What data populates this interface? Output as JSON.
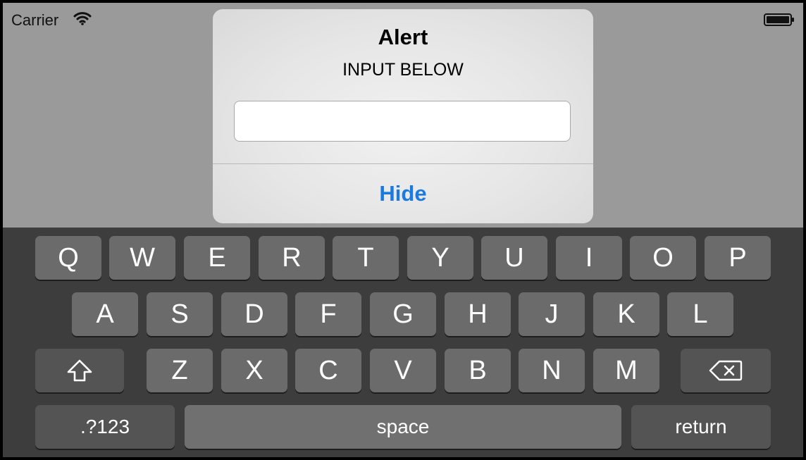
{
  "status_bar": {
    "carrier": "Carrier",
    "wifi_icon": "wifi-icon",
    "battery_icon": "battery-icon"
  },
  "alert": {
    "title": "Alert",
    "message": "INPUT BELOW",
    "input_value": "",
    "input_placeholder": "",
    "button_label": "Hide"
  },
  "keyboard": {
    "row1": [
      "Q",
      "W",
      "E",
      "R",
      "T",
      "Y",
      "U",
      "I",
      "O",
      "P"
    ],
    "row2": [
      "A",
      "S",
      "D",
      "F",
      "G",
      "H",
      "J",
      "K",
      "L"
    ],
    "row3": [
      "Z",
      "X",
      "C",
      "V",
      "B",
      "N",
      "M"
    ],
    "shift_icon": "shift-icon",
    "delete_icon": "delete-icon",
    "numbers_label": ".?123",
    "space_label": "space",
    "return_label": "return"
  },
  "colors": {
    "accent": "#1a7ae0",
    "dim_background": "#9a9a9a",
    "keyboard_background": "#3d3d3d",
    "key_background": "#6b6b6b"
  }
}
